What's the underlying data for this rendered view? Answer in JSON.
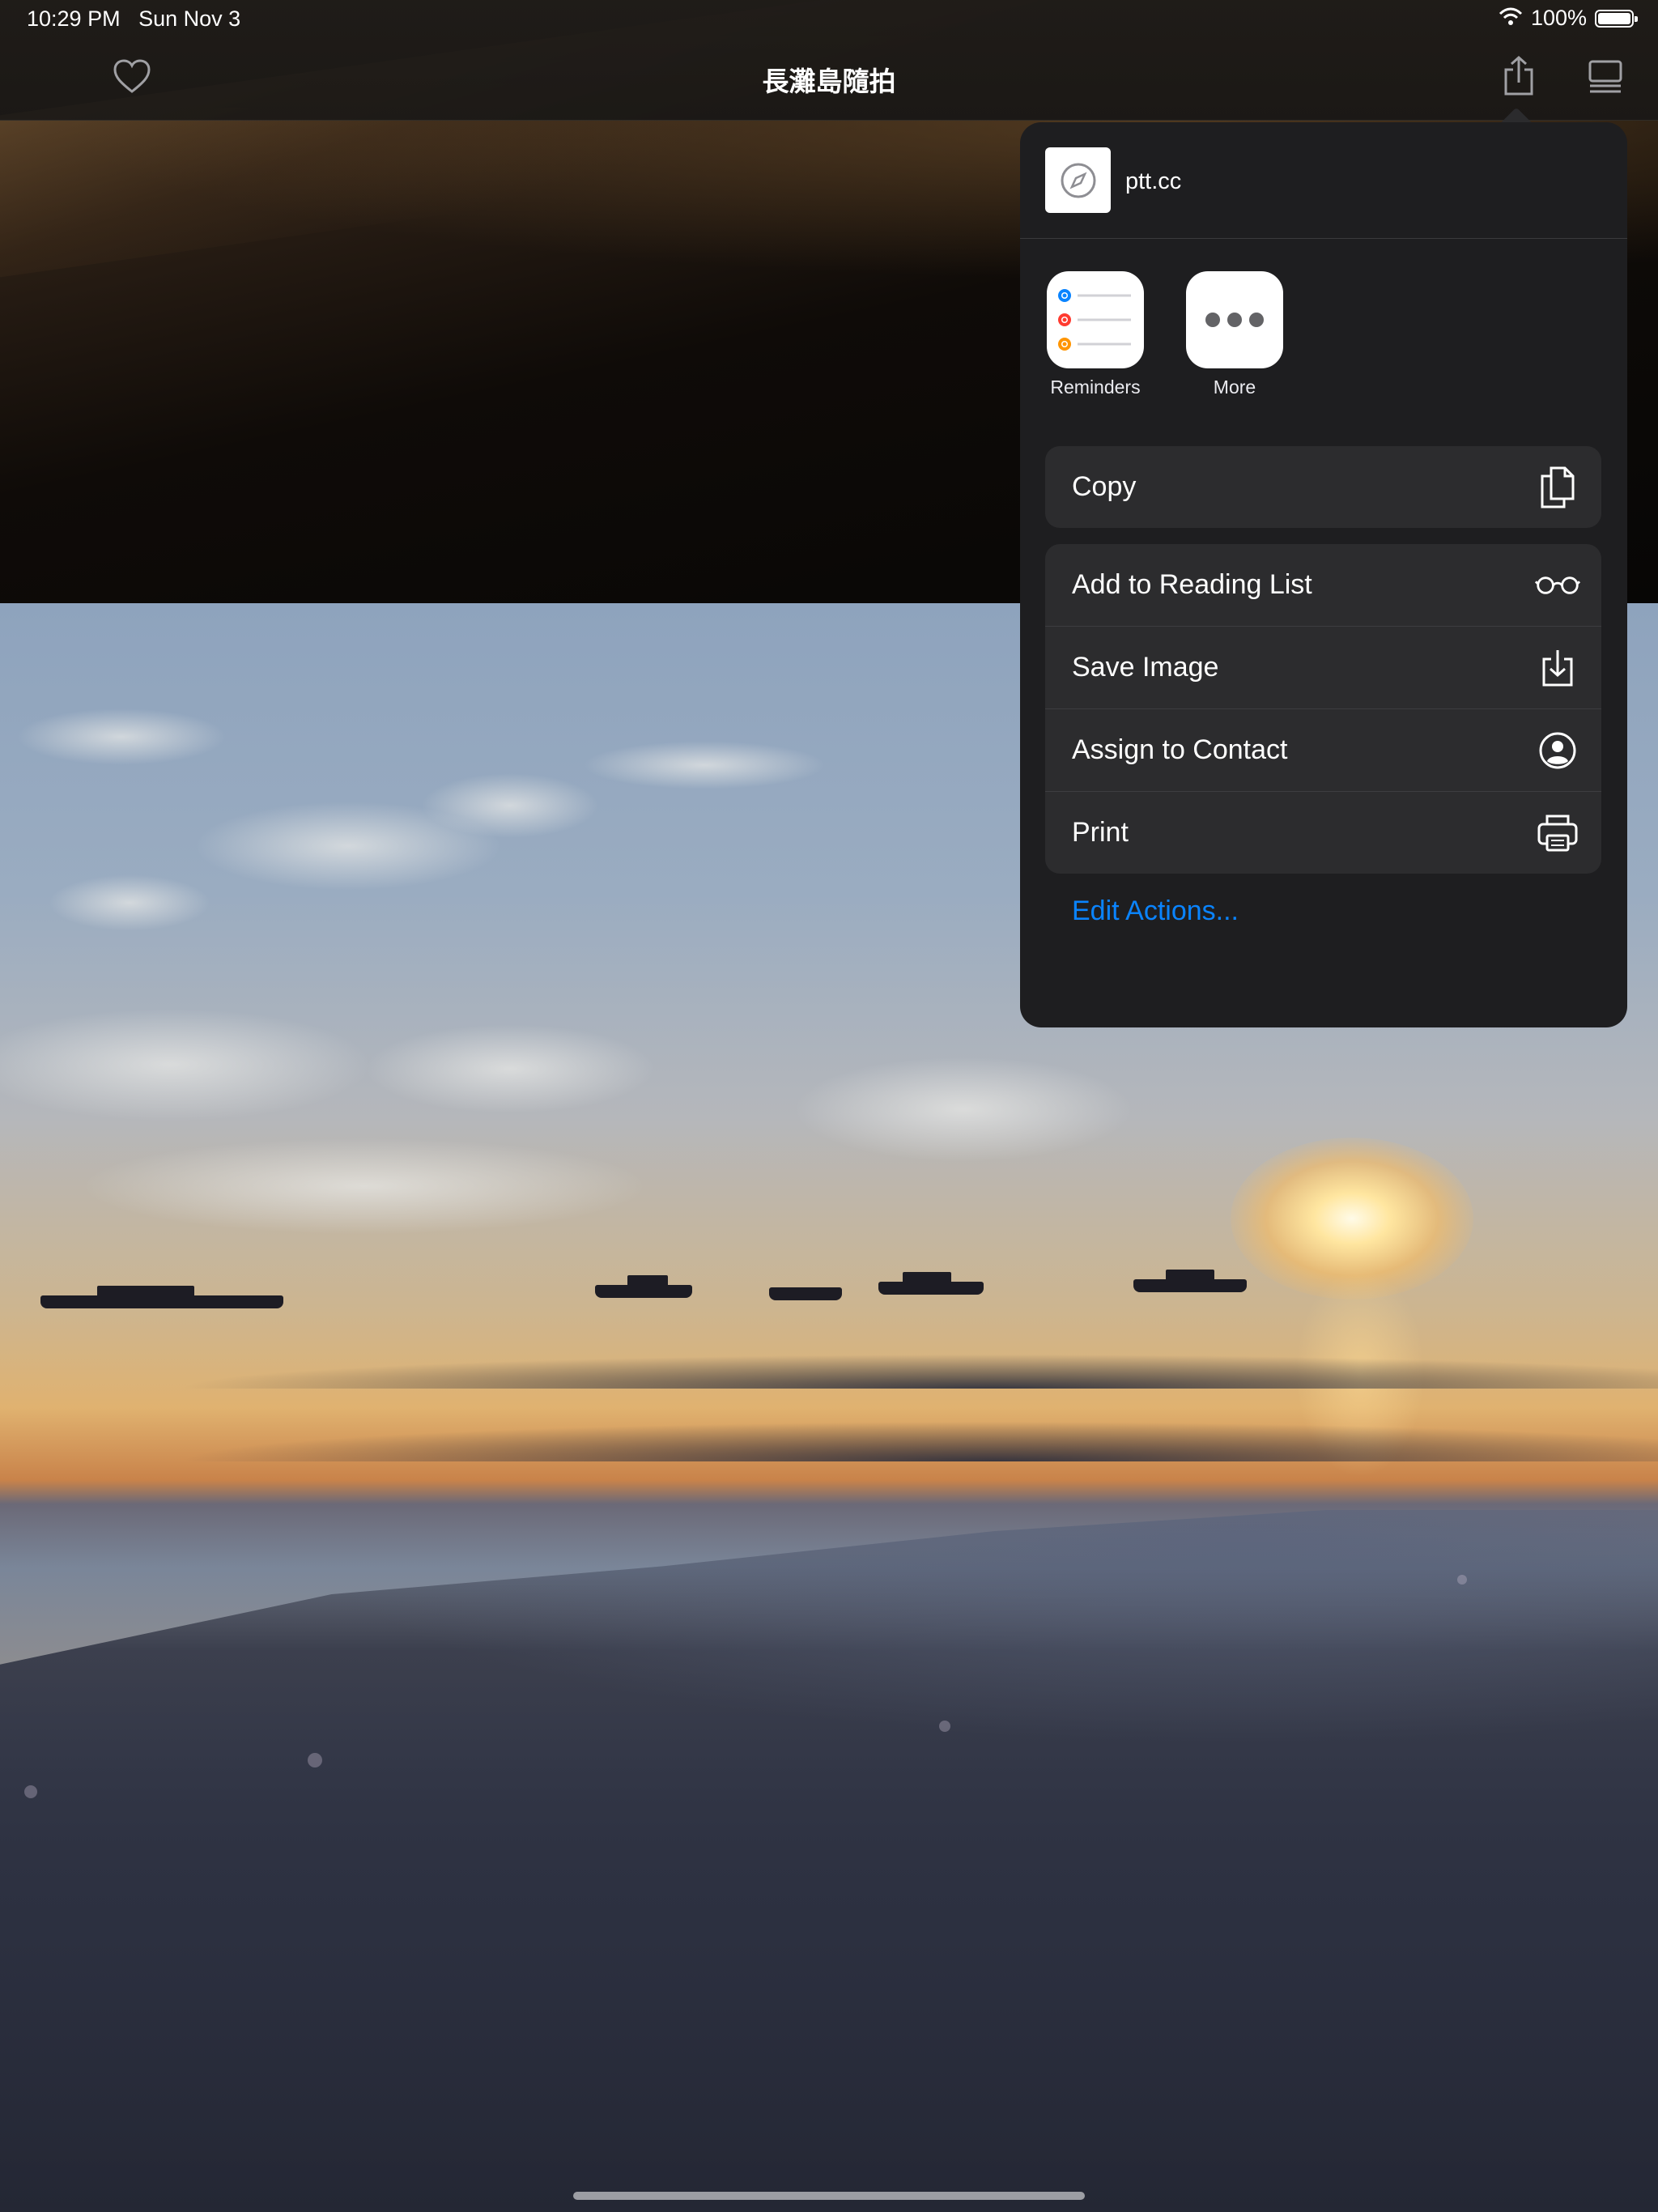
{
  "status_bar": {
    "time": "10:29 PM",
    "date": "Sun Nov 3",
    "battery": "100%"
  },
  "nav": {
    "title": "長灘島隨拍",
    "icons": [
      "heart-icon",
      "share-icon",
      "reader-list-icon"
    ]
  },
  "share_sheet": {
    "site": "ptt.cc",
    "apps": [
      {
        "label": "Reminders",
        "icon": "reminders-icon"
      },
      {
        "label": "More",
        "icon": "more-icon"
      }
    ],
    "copy_group": [
      {
        "label": "Copy",
        "icon": "copy-icon"
      }
    ],
    "actions": [
      {
        "label": "Add to Reading List",
        "icon": "glasses-icon"
      },
      {
        "label": "Save Image",
        "icon": "save-image-icon"
      },
      {
        "label": "Assign to Contact",
        "icon": "contact-icon"
      },
      {
        "label": "Print",
        "icon": "printer-icon"
      }
    ],
    "edit_actions": "Edit Actions..."
  },
  "colors": {
    "accent": "#0a84ff",
    "sheet_bg": "#1e1e20",
    "group_bg": "#2c2c2e"
  }
}
